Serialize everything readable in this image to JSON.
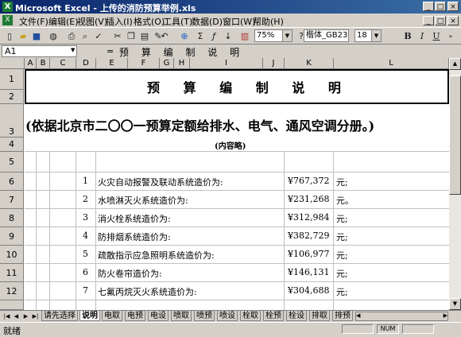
{
  "window": {
    "title": "Microsoft Excel - 上传的消防预算举例.xls",
    "min": "_",
    "max": "□",
    "close": "×"
  },
  "menu": [
    "文件(F)",
    "编辑(E)",
    "视图(V)",
    "插入(I)",
    "格式(O)",
    "工具(T)",
    "数据(D)",
    "窗口(W)",
    "帮助(H)"
  ],
  "toolbar": {
    "icons": [
      "new-file-icon",
      "open-icon",
      "save-icon",
      "permission-icon",
      "print-icon",
      "print-preview-icon",
      "spelling-icon",
      "cut-icon",
      "copy-icon",
      "paste-icon",
      "format-painter-icon",
      "undo-icon",
      "hyperlink-icon",
      "autosum-icon",
      "function-icon",
      "sort-ascending-icon",
      "chart-wizard-icon",
      "help-icon"
    ],
    "zoom": "75%",
    "font_name": "楷体_GB2312",
    "font_size": "18",
    "bold": "B",
    "italic": "I",
    "underline": "U"
  },
  "formula_bar": {
    "name_box": "A1",
    "equals": "=",
    "content": "预 算 编 制 说 明"
  },
  "columns": [
    "A",
    "B",
    "C",
    "D",
    "E",
    "F",
    "G",
    "H",
    "I",
    "J",
    "K",
    "L"
  ],
  "rows": [
    "1",
    "2",
    "3",
    "4",
    "5",
    "6",
    "7",
    "8",
    "9",
    "10",
    "11",
    "12"
  ],
  "sheet": {
    "title": "预 算 编 制 说 明",
    "subtitle": "(依据北京市二〇〇一预算定额给排水、电气、通风空调分册。)",
    "note": "(内容略)",
    "items": [
      {
        "num": "1",
        "desc": "火灾自动报警及联动系统造价为:",
        "amount": "¥767,372",
        "unit": "元;"
      },
      {
        "num": "2",
        "desc": "水喷淋灭火系统造价为:",
        "amount": "¥231,268",
        "unit": "元。"
      },
      {
        "num": "3",
        "desc": "消火栓系统造价为:",
        "amount": "¥312,984",
        "unit": "元;"
      },
      {
        "num": "4",
        "desc": "防排烟系统造价为:",
        "amount": "¥382,729",
        "unit": "元;"
      },
      {
        "num": "5",
        "desc": "疏散指示应急照明系统造价为:",
        "amount": "¥106,977",
        "unit": "元;"
      },
      {
        "num": "6",
        "desc": "防火卷帘造价为:",
        "amount": "¥146,131",
        "unit": "元;"
      },
      {
        "num": "7",
        "desc": "七氟丙烷灭火系统造价为:",
        "amount": "¥304,688",
        "unit": "元;"
      }
    ]
  },
  "tabs": [
    "请先选择",
    "说明",
    "电取",
    "电预",
    "电设",
    "喷取",
    "喷预",
    "喷设",
    "栓取",
    "栓预",
    "栓设",
    "排取",
    "排预"
  ],
  "active_tab": 1,
  "status": {
    "text": "就绪",
    "num": "NUM"
  }
}
